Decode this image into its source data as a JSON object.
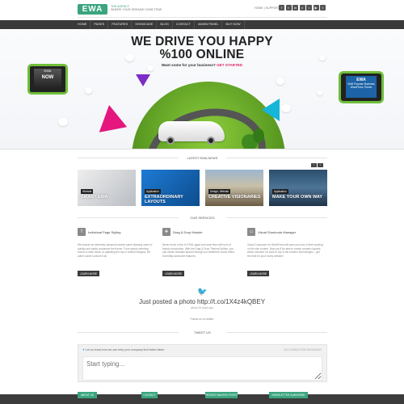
{
  "header": {
    "logo_text": "EWA",
    "tagline_line1": "THE AGENCY",
    "tagline_line2": "WHERE YOUR DREAMS COME TRUE",
    "top_links": "HOME | SUPPORT |",
    "social_icons": [
      "facebook-icon",
      "twitter-icon",
      "linkedin-icon",
      "vimeo-icon",
      "flickr-icon",
      "youtube-icon",
      "rss-icon"
    ]
  },
  "nav": {
    "items": [
      "HOME",
      "PAGES",
      "FEATURES",
      "SHOWCASE",
      "BLOG",
      "CONTACT",
      "ADMIN PANEL",
      "BUY NOW"
    ]
  },
  "hero": {
    "title_line1": "WE DRIVE YOU HAPPY",
    "title_line2": "%100 ONLINE",
    "subtitle": "Want some for your business?",
    "cta": "GET STARTED",
    "tablet_left_brand": "EWA",
    "tablet_left_now": "NOW",
    "tablet_right_brand": "EWA",
    "tablet_right_text": "Multi Purpose Business WordPress Theme"
  },
  "news": {
    "title": "LATEST EWA NEWS",
    "pager_prev": "‹",
    "pager_next": "›",
    "cards": [
      {
        "tag": "Website",
        "title": "SMART EWA",
        "color": "#c9ccd1"
      },
      {
        "tag": "Application",
        "title": "EXTRAORDINARY LAYOUTS",
        "color": "#1766b8"
      },
      {
        "tag": "Design, Website",
        "title": "CREATIVE VISIONARIES",
        "color": "#7b6a4f"
      },
      {
        "tag": "Application",
        "title": "MAKE YOUR OWN WAY",
        "color": "#375a77"
      }
    ]
  },
  "services": {
    "title": "OUR SERVICES",
    "items": [
      {
        "icon": "T",
        "title": "Individual Page Styling",
        "body": "We include an extremely advanced admin panel allowing users to quickly and easily customize the theme. From simply selecting boxed or wide mode, to adjusting the top or bottom margins, the admin panel controls it all.",
        "more": "LEARN MORE"
      },
      {
        "icon": "✥",
        "title": "Drag & Drop Module",
        "body": "Never touch a line of HTML again and save time with tons of beauty shortcodes. With the Drag & Drop Themes Builder, you can create beautiful layouts through our whitelevel visual editor. Incredibly awesome features.",
        "more": "LEARN MORE"
      },
      {
        "icon": "▭",
        "title": "Visual Shortcode Manager",
        "body": "Visual Composer for WordPress will save you tons of time working on the site content. Now you'll be able to create complex layouts within minutes! It's built on top of the modern technologies – get the best for your lovely website!",
        "more": "LEARN MORE"
      }
    ]
  },
  "tweet": {
    "text": "Just posted a photo http://t.co/1X4z4kQBEY",
    "time": "about 16 days ago",
    "follow": "Follow us on twitter"
  },
  "tweet_us": {
    "title": "TWEET US",
    "label_prefix": "Let us know how we can help your company find better talent",
    "counter": "NO CHARACTERS REMAINING",
    "placeholder": "Start typing..."
  },
  "footer": {
    "tabs": [
      "ABOUT US",
      "CONTACT",
      "RECENT WANTED POSTS",
      "NEWSLETTER SUBSCRIBE"
    ]
  },
  "colors": {
    "brand_green": "#3aa57f",
    "nav_dark": "#3a3a3a",
    "cta_pink": "#e0245e",
    "twitter_blue": "#1da1f2"
  }
}
